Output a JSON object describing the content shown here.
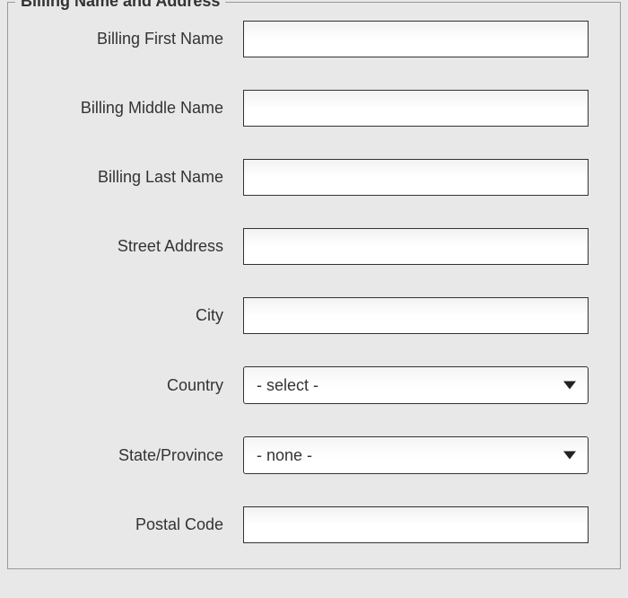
{
  "section_title": "Billing Name and Address",
  "fields": {
    "first_name": {
      "label": "Billing First Name",
      "value": ""
    },
    "middle_name": {
      "label": "Billing Middle Name",
      "value": ""
    },
    "last_name": {
      "label": "Billing Last Name",
      "value": ""
    },
    "street": {
      "label": "Street Address",
      "value": ""
    },
    "city": {
      "label": "City",
      "value": ""
    },
    "country": {
      "label": "Country",
      "selected": "- select -"
    },
    "state": {
      "label": "State/Province",
      "selected": "- none -"
    },
    "postal": {
      "label": "Postal Code",
      "value": ""
    }
  }
}
